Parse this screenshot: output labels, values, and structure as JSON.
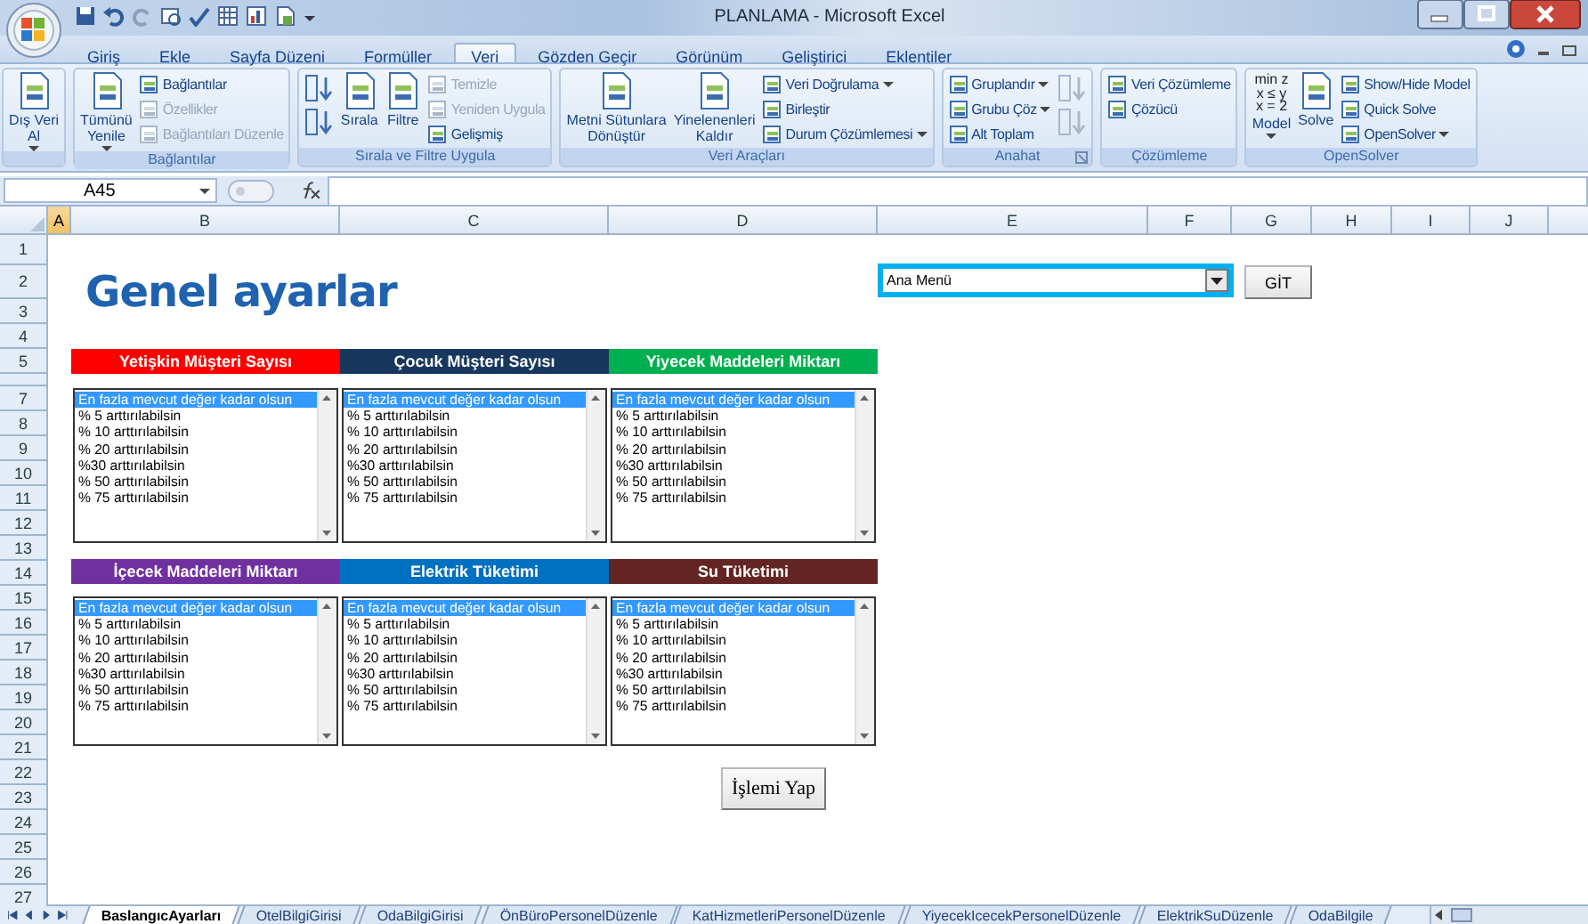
{
  "window": {
    "title": "PLANLAMA - Microsoft Excel"
  },
  "ribbon_tabs": [
    {
      "label": "Giriş",
      "selected": false
    },
    {
      "label": "Ekle",
      "selected": false
    },
    {
      "label": "Sayfa Düzeni",
      "selected": false
    },
    {
      "label": "Formüller",
      "selected": false
    },
    {
      "label": "Veri",
      "selected": true
    },
    {
      "label": "Gözden Geçir",
      "selected": false
    },
    {
      "label": "Görünüm",
      "selected": false
    },
    {
      "label": "Geliştirici",
      "selected": false
    },
    {
      "label": "Eklentiler",
      "selected": false
    }
  ],
  "ribbon_groups": [
    {
      "columns": [
        [
          {
            "kind": "large",
            "label": "Dış Veri\nAl",
            "dropdown": true,
            "disabled": false
          }
        ]
      ]
    },
    {
      "label": "Bağlantılar",
      "columns": [
        [
          {
            "kind": "large",
            "label": "Tümünü\nYenile",
            "dropdown": true,
            "disabled": false
          }
        ],
        [
          {
            "kind": "small",
            "label": "Bağlantılar",
            "disabled": false
          },
          {
            "kind": "small",
            "label": "Özellikler",
            "disabled": true
          },
          {
            "kind": "small",
            "label": "Bağlantıları Düzenle",
            "disabled": true
          }
        ]
      ]
    },
    {
      "label": "Sırala ve Filtre Uygula",
      "columns": [
        [
          {
            "kind": "icon",
            "disabled": false
          },
          {
            "kind": "icon",
            "disabled": false
          }
        ],
        [
          {
            "kind": "large",
            "label": "Sırala",
            "disabled": false
          }
        ],
        [
          {
            "kind": "large",
            "label": "Filtre",
            "disabled": false
          }
        ],
        [
          {
            "kind": "small",
            "label": "Temizle",
            "disabled": true
          },
          {
            "kind": "small",
            "label": "Yeniden Uygula",
            "disabled": true
          },
          {
            "kind": "small",
            "label": "Gelişmiş",
            "disabled": false
          }
        ]
      ]
    },
    {
      "label": "Veri Araçları",
      "columns": [
        [
          {
            "kind": "large",
            "label": "Metni Sütunlara\nDönüştür",
            "disabled": false
          }
        ],
        [
          {
            "kind": "large",
            "label": "Yinelenenleri\nKaldır",
            "disabled": false
          }
        ],
        [
          {
            "kind": "small",
            "label": "Veri Doğrulama",
            "dropdown": true,
            "disabled": false
          },
          {
            "kind": "small",
            "label": "Birleştir",
            "disabled": false
          },
          {
            "kind": "small",
            "label": "Durum Çözümlemesi",
            "dropdown": true,
            "disabled": false
          }
        ]
      ]
    },
    {
      "label": "Anahat",
      "launcher": true,
      "columns": [
        [
          {
            "kind": "small",
            "label": "Gruplandır",
            "dropdown": true,
            "disabled": false
          },
          {
            "kind": "small",
            "label": "Grubu Çöz",
            "dropdown": true,
            "disabled": false
          },
          {
            "kind": "small",
            "label": "Alt Toplam",
            "disabled": false
          }
        ],
        [
          {
            "kind": "icon",
            "disabled": true
          },
          {
            "kind": "icon",
            "disabled": true
          }
        ]
      ]
    },
    {
      "label": "Çözümleme",
      "columns": [
        [
          {
            "kind": "small",
            "label": "Veri Çözümleme",
            "disabled": false
          },
          {
            "kind": "small",
            "label": "Çözücü",
            "disabled": false
          }
        ]
      ]
    },
    {
      "label": "OpenSolver",
      "columns": [
        [
          {
            "kind": "large",
            "label": "Model",
            "icon_text": "min z\nx ≤ y\nx = 2",
            "dropdown": true,
            "disabled": false
          }
        ],
        [
          {
            "kind": "large",
            "label": "Solve",
            "disabled": false
          }
        ],
        [
          {
            "kind": "small",
            "label": "Show/Hide Model",
            "disabled": false
          },
          {
            "kind": "small",
            "label": "Quick Solve",
            "disabled": false
          },
          {
            "kind": "small",
            "label": "OpenSolver",
            "dropdown": true,
            "disabled": false
          }
        ]
      ]
    }
  ],
  "name_box": "A45",
  "columns": [
    {
      "label": "A",
      "selected": true
    },
    {
      "label": "B",
      "selected": false
    },
    {
      "label": "C",
      "selected": false
    },
    {
      "label": "D",
      "selected": false
    },
    {
      "label": "E",
      "selected": false
    },
    {
      "label": "F",
      "selected": false
    },
    {
      "label": "G",
      "selected": false
    },
    {
      "label": "H",
      "selected": false
    },
    {
      "label": "I",
      "selected": false
    },
    {
      "label": "J",
      "selected": false
    }
  ],
  "rows": [
    "1",
    "2",
    "3",
    "4",
    "5",
    "7",
    "8",
    "9",
    "10",
    "11",
    "12",
    "13",
    "14",
    "15",
    "16",
    "17",
    "18",
    "19",
    "20",
    "21",
    "22",
    "23",
    "24",
    "25",
    "26",
    "27"
  ],
  "sheet": {
    "title": "Genel ayarlar",
    "menu_dropdown": {
      "value": "Ana Menü"
    },
    "go_button": "GİT",
    "panels": [
      {
        "header": "Yetişkin Müşteri Sayısı",
        "color": "#ff0000",
        "items": [
          {
            "text": "En fazla mevcut değer kadar olsun",
            "selected": true
          },
          {
            "text": "% 5 arttırılabilsin",
            "selected": false
          },
          {
            "text": "% 10 arttırılabilsin",
            "selected": false
          },
          {
            "text": "% 20 arttırılabilsin",
            "selected": false
          },
          {
            "text": "%30 arttırılabilsin",
            "selected": false
          },
          {
            "text": "% 50 arttırılabilsin",
            "selected": false
          },
          {
            "text": "% 75 arttırılabilsin",
            "selected": false
          }
        ]
      },
      {
        "header": "Çocuk Müşteri Sayısı",
        "color": "#17375e",
        "items": [
          {
            "text": "En fazla mevcut değer kadar olsun",
            "selected": true
          },
          {
            "text": "% 5 arttırılabilsin",
            "selected": false
          },
          {
            "text": "% 10 arttırılabilsin",
            "selected": false
          },
          {
            "text": "% 20 arttırılabilsin",
            "selected": false
          },
          {
            "text": "%30 arttırılabilsin",
            "selected": false
          },
          {
            "text": "% 50 arttırılabilsin",
            "selected": false
          },
          {
            "text": "% 75 arttırılabilsin",
            "selected": false
          }
        ]
      },
      {
        "header": "Yiyecek Maddeleri Miktarı",
        "color": "#00b050",
        "items": [
          {
            "text": "En fazla mevcut değer kadar olsun",
            "selected": true
          },
          {
            "text": "% 5 arttırılabilsin",
            "selected": false
          },
          {
            "text": "% 10 arttırılabilsin",
            "selected": false
          },
          {
            "text": "% 20 arttırılabilsin",
            "selected": false
          },
          {
            "text": "%30 arttırılabilsin",
            "selected": false
          },
          {
            "text": "% 50 arttırılabilsin",
            "selected": false
          },
          {
            "text": "% 75 arttırılabilsin",
            "selected": false
          }
        ]
      },
      {
        "header": "İçecek Maddeleri Miktarı",
        "color": "#7030a0",
        "items": [
          {
            "text": "En fazla mevcut değer kadar olsun",
            "selected": true
          },
          {
            "text": "% 5 arttırılabilsin",
            "selected": false
          },
          {
            "text": "% 10 arttırılabilsin",
            "selected": false
          },
          {
            "text": "% 20 arttırılabilsin",
            "selected": false
          },
          {
            "text": "%30 arttırılabilsin",
            "selected": false
          },
          {
            "text": "% 50 arttırılabilsin",
            "selected": false
          },
          {
            "text": "% 75 arttırılabilsin",
            "selected": false
          }
        ]
      },
      {
        "header": "Elektrik Tüketimi",
        "color": "#0070c0",
        "items": [
          {
            "text": "En fazla mevcut değer kadar olsun",
            "selected": true
          },
          {
            "text": "% 5 arttırılabilsin",
            "selected": false
          },
          {
            "text": "% 10 arttırılabilsin",
            "selected": false
          },
          {
            "text": "% 20 arttırılabilsin",
            "selected": false
          },
          {
            "text": "%30 arttırılabilsin",
            "selected": false
          },
          {
            "text": "% 50 arttırılabilsin",
            "selected": false
          },
          {
            "text": "% 75 arttırılabilsin",
            "selected": false
          }
        ]
      },
      {
        "header": "Su Tüketimi",
        "color": "#632523",
        "items": [
          {
            "text": "En fazla mevcut değer kadar olsun",
            "selected": true
          },
          {
            "text": "% 5 arttırılabilsin",
            "selected": false
          },
          {
            "text": "% 10 arttırılabilsin",
            "selected": false
          },
          {
            "text": "% 20 arttırılabilsin",
            "selected": false
          },
          {
            "text": "%30 arttırılabilsin",
            "selected": false
          },
          {
            "text": "% 50 arttırılabilsin",
            "selected": false
          },
          {
            "text": "% 75 arttırılabilsin",
            "selected": false
          }
        ]
      }
    ],
    "run_button": "İşlemi Yap"
  },
  "sheet_tabs": [
    {
      "label": "BaslangıcAyarları",
      "selected": true
    },
    {
      "label": "OtelBilgiGirisi",
      "selected": false
    },
    {
      "label": "OdaBilgiGirisi",
      "selected": false
    },
    {
      "label": "ÖnBüroPersonelDüzenle",
      "selected": false
    },
    {
      "label": "KatHizmetleriPersonelDüzenle",
      "selected": false
    },
    {
      "label": "YiyecekIcecekPersonelDüzenle",
      "selected": false
    },
    {
      "label": "ElektrikSuDüzenle",
      "selected": false
    },
    {
      "label": "OdaBilgile",
      "selected": false
    }
  ]
}
